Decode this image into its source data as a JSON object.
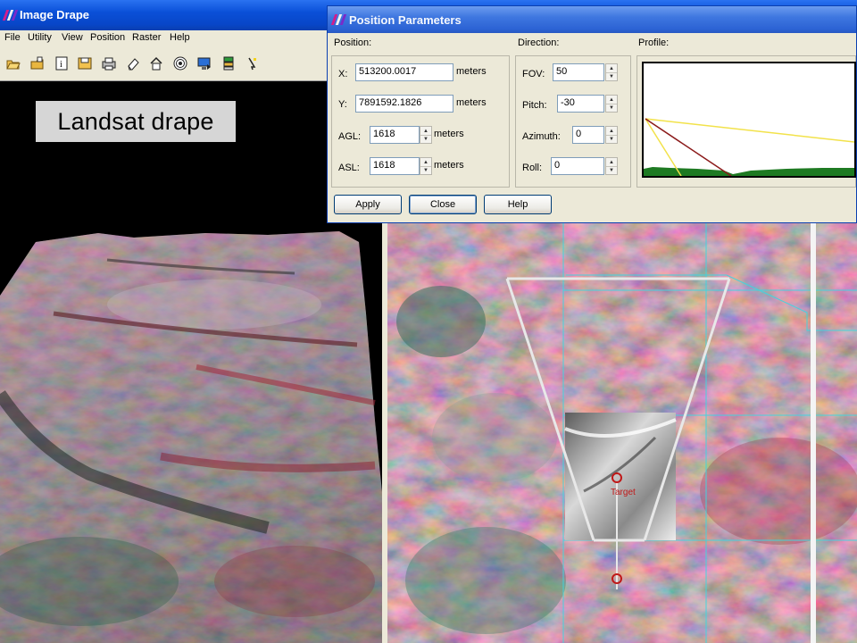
{
  "drape_window": {
    "title": "Image Drape",
    "menu": [
      "File",
      "Utility",
      "View",
      "Position",
      "Raster",
      "Help"
    ],
    "toolbar_icons": [
      "open-folder-icon",
      "open-file-icon",
      "info-icon",
      "save-icon",
      "print-icon",
      "eraser-icon",
      "home-icon",
      "target-icon",
      "screen-icon",
      "layers-icon",
      "pointer-icon"
    ],
    "view_label": "Landsat drape",
    "target_label": "Target"
  },
  "position_dialog": {
    "title": "Position Parameters",
    "position": {
      "group_label": "Position:",
      "x_label": "X:",
      "x_value": "513200.0017",
      "x_unit": "meters",
      "y_label": "Y:",
      "y_value": "7891592.1826",
      "y_unit": "meters",
      "agl_label": "AGL:",
      "agl_value": "1618",
      "agl_unit": "meters",
      "asl_label": "ASL:",
      "asl_value": "1618",
      "asl_unit": "meters"
    },
    "direction": {
      "group_label": "Direction:",
      "fov_label": "FOV:",
      "fov_value": "50",
      "pitch_label": "Pitch:",
      "pitch_value": "-30",
      "azimuth_label": "Azimuth:",
      "azimuth_value": "0",
      "roll_label": "Roll:",
      "roll_value": "0"
    },
    "profile": {
      "group_label": "Profile:"
    },
    "buttons": {
      "apply": "Apply",
      "close": "Close",
      "help": "Help"
    }
  },
  "colors": {
    "title_bar": "#0A50D8",
    "dialog_title_bar": "#3F77E0",
    "window_face": "#ECE9D8",
    "grid_line": "#3FD6E0",
    "profile_sight_line": "#F2E24A",
    "profile_ray_line": "#8B1A1A",
    "profile_terrain": "#1E7A22"
  }
}
